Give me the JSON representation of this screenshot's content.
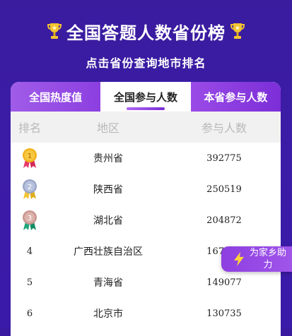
{
  "header": {
    "title": "全国答题人数省份榜",
    "subtitle": "点击省份查询地市排名"
  },
  "tabs": [
    {
      "label": "全国热度值",
      "active": false
    },
    {
      "label": "全国参与人数",
      "active": true
    },
    {
      "label": "本省参与人数",
      "active": false
    }
  ],
  "table": {
    "columns": [
      "排名",
      "地区",
      "参与人数"
    ],
    "rows": [
      {
        "rank": "1",
        "medal": "gold",
        "region": "贵州省",
        "count": "392775"
      },
      {
        "rank": "2",
        "medal": "silver",
        "region": "陕西省",
        "count": "250519"
      },
      {
        "rank": "3",
        "medal": "bronze",
        "region": "湖北省",
        "count": "204872"
      },
      {
        "rank": "4",
        "region": "广西壮族自治区",
        "count": "167161"
      },
      {
        "rank": "5",
        "region": "青海省",
        "count": "149077"
      },
      {
        "rank": "6",
        "region": "北京市",
        "count": "130735"
      }
    ]
  },
  "float_button": {
    "label": "为家乡助力",
    "icon": "lightning-icon"
  },
  "colors": {
    "background": "#3a1aa0",
    "tab_purple": "#8c3fe0",
    "medal_gold": "#f3b21c",
    "medal_silver": "#9aa6c8",
    "medal_bronze": "#c9978f"
  }
}
